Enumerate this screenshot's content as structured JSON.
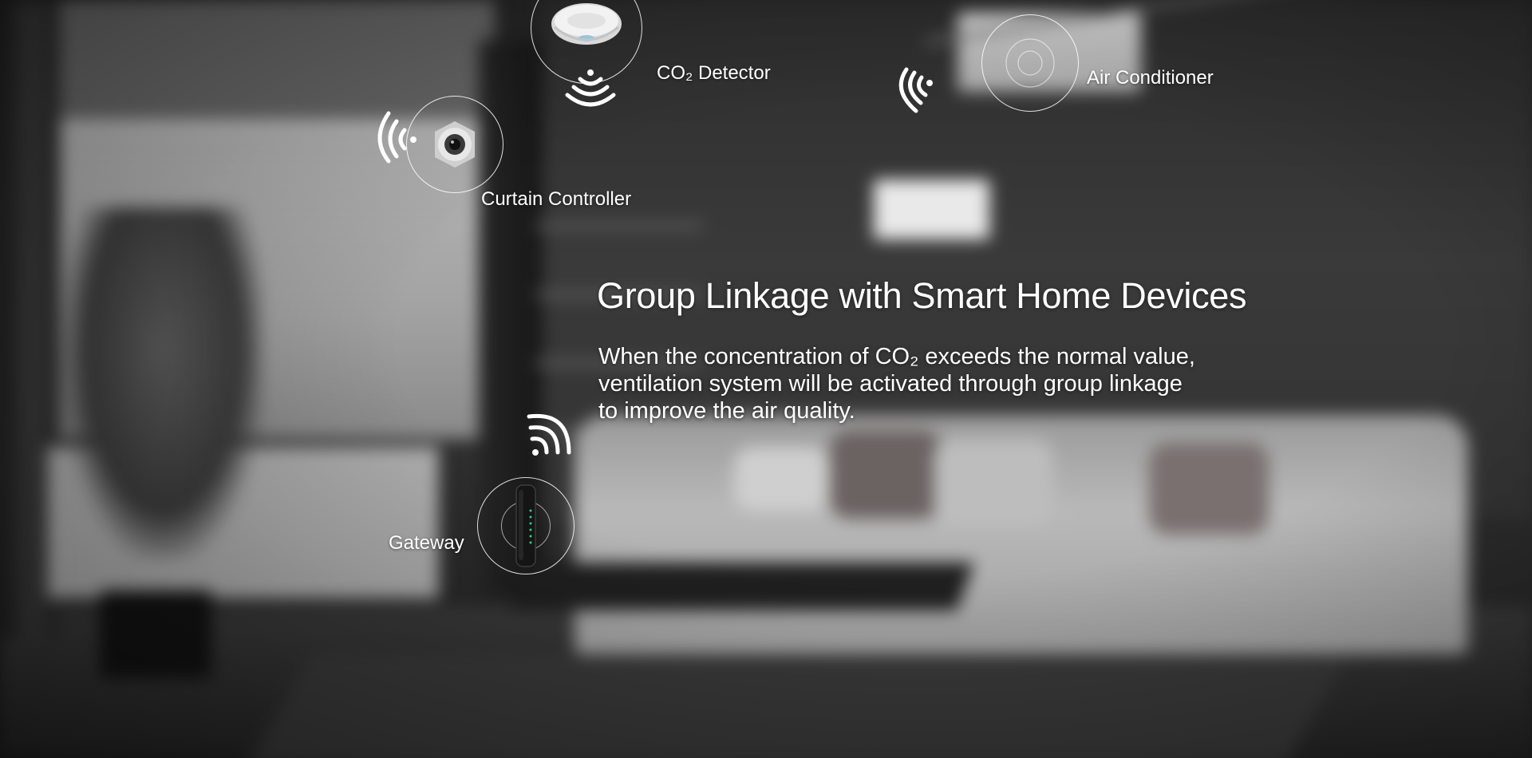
{
  "headline": "Group Linkage with Smart Home Devices",
  "description": {
    "lines": [
      "When the concentration of CO₂ exceeds the normal value,",
      "ventilation system will be activated through group linkage",
      "to improve the air quality."
    ]
  },
  "devices": {
    "co2_detector": {
      "label": "CO₂ Detector",
      "icon": "co2-detector-icon"
    },
    "air_conditioner": {
      "label": "Air Conditioner",
      "icon": "air-conditioner-icon"
    },
    "curtain_controller": {
      "label": "Curtain Controller",
      "icon": "curtain-controller-icon"
    },
    "gateway": {
      "label": "Gateway",
      "icon": "gateway-icon"
    }
  },
  "colors": {
    "text": "#ffffff",
    "ring": "#ffffff"
  }
}
